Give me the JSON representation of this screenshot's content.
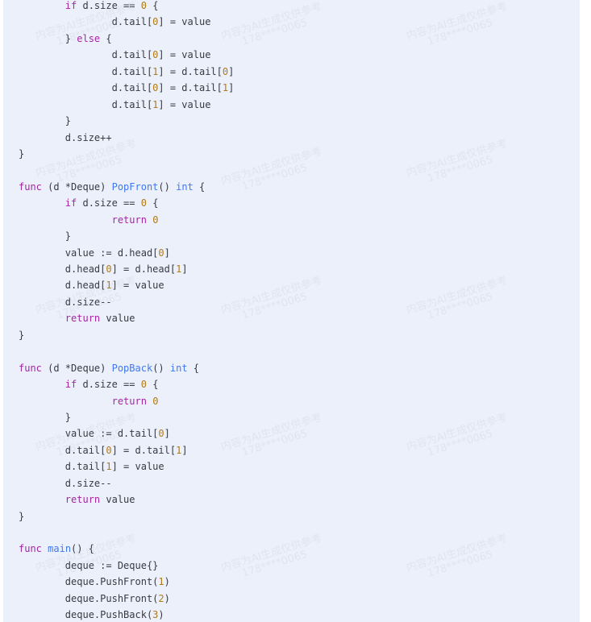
{
  "code_lines": [
    [
      {
        "t": "        "
      },
      {
        "t": "if",
        "c": "kw"
      },
      {
        "t": " d.size == "
      },
      {
        "t": "0",
        "c": "num"
      },
      {
        "t": " {"
      }
    ],
    [
      {
        "t": "                d.tail["
      },
      {
        "t": "0",
        "c": "num"
      },
      {
        "t": "] = value"
      }
    ],
    [
      {
        "t": "        } "
      },
      {
        "t": "else",
        "c": "kw"
      },
      {
        "t": " {"
      }
    ],
    [
      {
        "t": "                d.tail["
      },
      {
        "t": "0",
        "c": "num"
      },
      {
        "t": "] = value"
      }
    ],
    [
      {
        "t": "                d.tail["
      },
      {
        "t": "1",
        "c": "num"
      },
      {
        "t": "] = d.tail["
      },
      {
        "t": "0",
        "c": "num"
      },
      {
        "t": "]"
      }
    ],
    [
      {
        "t": "                d.tail["
      },
      {
        "t": "0",
        "c": "num"
      },
      {
        "t": "] = d.tail["
      },
      {
        "t": "1",
        "c": "num"
      },
      {
        "t": "]"
      }
    ],
    [
      {
        "t": "                d.tail["
      },
      {
        "t": "1",
        "c": "num"
      },
      {
        "t": "] = value"
      }
    ],
    [
      {
        "t": "        }"
      }
    ],
    [
      {
        "t": "        d.size++"
      }
    ],
    [
      {
        "t": "}"
      }
    ],
    [
      {
        "t": ""
      }
    ],
    [
      {
        "t": "func",
        "c": "kw"
      },
      {
        "t": " (d *Deque) "
      },
      {
        "t": "PopFront",
        "c": "fn"
      },
      {
        "t": "() "
      },
      {
        "t": "int",
        "c": "ty"
      },
      {
        "t": " {"
      }
    ],
    [
      {
        "t": "        "
      },
      {
        "t": "if",
        "c": "kw"
      },
      {
        "t": " d.size == "
      },
      {
        "t": "0",
        "c": "num"
      },
      {
        "t": " {"
      }
    ],
    [
      {
        "t": "                "
      },
      {
        "t": "return",
        "c": "kw"
      },
      {
        "t": " "
      },
      {
        "t": "0",
        "c": "num"
      }
    ],
    [
      {
        "t": "        }"
      }
    ],
    [
      {
        "t": "        value := d.head["
      },
      {
        "t": "0",
        "c": "num"
      },
      {
        "t": "]"
      }
    ],
    [
      {
        "t": "        d.head["
      },
      {
        "t": "0",
        "c": "num"
      },
      {
        "t": "] = d.head["
      },
      {
        "t": "1",
        "c": "num"
      },
      {
        "t": "]"
      }
    ],
    [
      {
        "t": "        d.head["
      },
      {
        "t": "1",
        "c": "num"
      },
      {
        "t": "] = value"
      }
    ],
    [
      {
        "t": "        d.size--"
      }
    ],
    [
      {
        "t": "        "
      },
      {
        "t": "return",
        "c": "kw"
      },
      {
        "t": " value"
      }
    ],
    [
      {
        "t": "}"
      }
    ],
    [
      {
        "t": ""
      }
    ],
    [
      {
        "t": "func",
        "c": "kw"
      },
      {
        "t": " (d *Deque) "
      },
      {
        "t": "PopBack",
        "c": "fn"
      },
      {
        "t": "() "
      },
      {
        "t": "int",
        "c": "ty"
      },
      {
        "t": " {"
      }
    ],
    [
      {
        "t": "        "
      },
      {
        "t": "if",
        "c": "kw"
      },
      {
        "t": " d.size == "
      },
      {
        "t": "0",
        "c": "num"
      },
      {
        "t": " {"
      }
    ],
    [
      {
        "t": "                "
      },
      {
        "t": "return",
        "c": "kw"
      },
      {
        "t": " "
      },
      {
        "t": "0",
        "c": "num"
      }
    ],
    [
      {
        "t": "        }"
      }
    ],
    [
      {
        "t": "        value := d.tail["
      },
      {
        "t": "0",
        "c": "num"
      },
      {
        "t": "]"
      }
    ],
    [
      {
        "t": "        d.tail["
      },
      {
        "t": "0",
        "c": "num"
      },
      {
        "t": "] = d.tail["
      },
      {
        "t": "1",
        "c": "num"
      },
      {
        "t": "]"
      }
    ],
    [
      {
        "t": "        d.tail["
      },
      {
        "t": "1",
        "c": "num"
      },
      {
        "t": "] = value"
      }
    ],
    [
      {
        "t": "        d.size--"
      }
    ],
    [
      {
        "t": "        "
      },
      {
        "t": "return",
        "c": "kw"
      },
      {
        "t": " value"
      }
    ],
    [
      {
        "t": "}"
      }
    ],
    [
      {
        "t": ""
      }
    ],
    [
      {
        "t": "func",
        "c": "kw"
      },
      {
        "t": " "
      },
      {
        "t": "main",
        "c": "fn"
      },
      {
        "t": "() {"
      }
    ],
    [
      {
        "t": "        deque := Deque{}"
      }
    ],
    [
      {
        "t": "        deque.PushFront("
      },
      {
        "t": "1",
        "c": "num"
      },
      {
        "t": ")"
      }
    ],
    [
      {
        "t": "        deque.PushFront("
      },
      {
        "t": "2",
        "c": "num"
      },
      {
        "t": ")"
      }
    ],
    [
      {
        "t": "        deque.PushBack("
      },
      {
        "t": "3",
        "c": "num"
      },
      {
        "t": ")"
      }
    ]
  ],
  "watermark": {
    "line1": "内容为AI生成仅供参考",
    "line2": "178****0065"
  },
  "colors": {
    "background": "#ebf0fb",
    "keyword": "#a626a4",
    "function": "#4078f2",
    "number": "#b07a18",
    "text": "#383a42"
  }
}
